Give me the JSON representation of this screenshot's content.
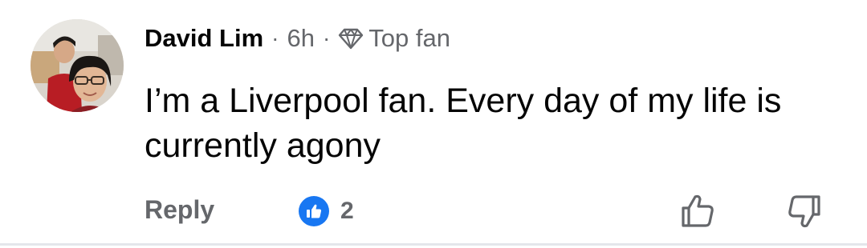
{
  "comment": {
    "author": "David Lim",
    "time": "6h",
    "separator": "·",
    "badge": {
      "label": "Top fan",
      "icon": "diamond-icon"
    },
    "text": "I’m a Liverpool fan. Every day of my life is currently agony",
    "actions": {
      "reply_label": "Reply",
      "reaction_icon": "thumbs-up-icon",
      "reaction_count": "2",
      "upvote_icon": "thumbs-up-outline-icon",
      "downvote_icon": "thumbs-down-outline-icon"
    }
  },
  "colors": {
    "text_primary": "#050505",
    "text_secondary": "#65676b",
    "accent": "#1877f2",
    "divider": "#e4e6eb"
  }
}
